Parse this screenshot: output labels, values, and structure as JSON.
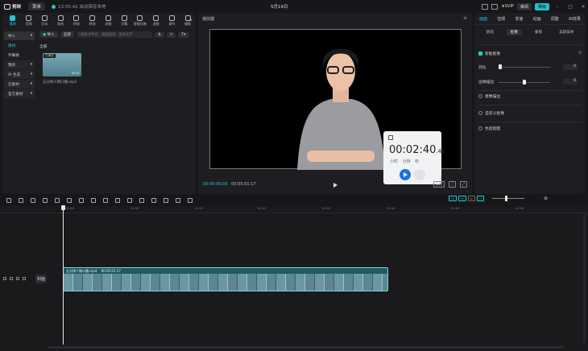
{
  "topbar": {
    "app_name": "剪映",
    "menu_label": "菜单",
    "autosave": "13:55:42 自动保存本地",
    "project_title": "5月19日",
    "svip": "SVIP",
    "review": "审阅",
    "export": "导出"
  },
  "media_toolbar": {
    "tools": [
      "素材",
      "音频",
      "文本",
      "贴纸",
      "特效",
      "转场",
      "滤镜",
      "字幕",
      "智能包装",
      "滤镜",
      "调节",
      "模板"
    ]
  },
  "left_sidebar": {
    "items": [
      "导入",
      "素材",
      "字幕稿",
      "我的",
      "AI 生成",
      "云素材",
      "官方素材"
    ]
  },
  "media_library": {
    "import_btn": "导入",
    "view_label": "全部",
    "search_placeholder": "搜索文件名、画面描述、语音文字",
    "all_label": "全部",
    "clip_tag": "已添加",
    "clip_duration": "05:01",
    "clip_name": "五分钟人物口播.mp4"
  },
  "player": {
    "title": "播放器",
    "current_time": "00:00:00:00",
    "total_time": "00:05:01:17",
    "ratio_label": "比例",
    "stopwatch": {
      "time_main": "00:02:40",
      "time_ms": ".41",
      "units": "小时 分钟 秒"
    }
  },
  "right_panel": {
    "tabs": [
      "画面",
      "音频",
      "变速",
      "动画",
      "调整",
      "AI效果"
    ],
    "subtabs": [
      "基础",
      "抠像",
      "蒙版",
      "美颜美体"
    ],
    "smart_cutout": "智能抠像",
    "feather_label": "羽化",
    "feather_value": "0",
    "edge_label": "边缘描边",
    "edge_value": "0",
    "stroke_label": "抠像描边",
    "custom_label": "自定义抠像",
    "chroma_label": "色度抠图"
  },
  "timeline": {
    "ruler": [
      "00:00",
      "00:00",
      "00:01",
      "00:02",
      "00:03",
      "00:04",
      "00:05",
      "00:06"
    ],
    "cover_label": "封面",
    "clip_label": "五分钟人物口播.mp4",
    "clip_duration": "00:05:01:17"
  }
}
